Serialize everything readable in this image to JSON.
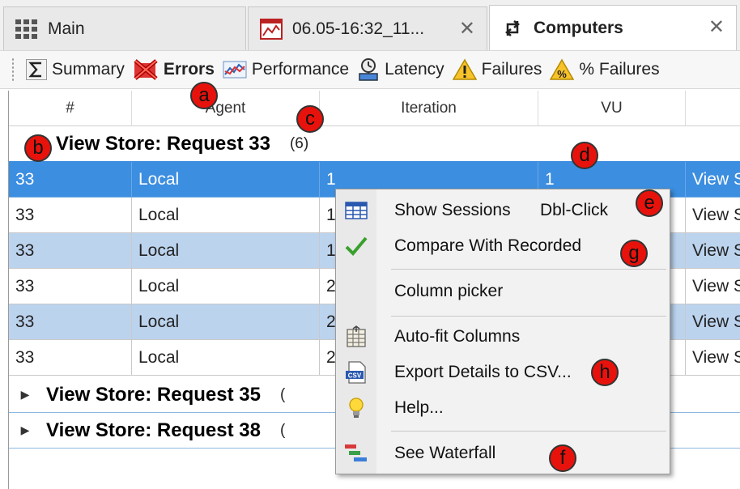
{
  "tabs": [
    {
      "label": "Main",
      "icon": "grid-icon",
      "closable": false,
      "active": false
    },
    {
      "label": "06.05-16:32_11...",
      "icon": "chart-icon",
      "closable": true,
      "active": false
    },
    {
      "label": "Computers",
      "icon": "swap-arrows-icon",
      "closable": true,
      "active": true
    }
  ],
  "tab_close_glyph": "✕",
  "toolbar": {
    "items": [
      {
        "label": "Summary",
        "icon": "sigma-icon"
      },
      {
        "label": "Errors",
        "icon": "errors-icon",
        "bold": true
      },
      {
        "label": "Performance",
        "icon": "performance-icon"
      },
      {
        "label": "Latency",
        "icon": "latency-icon"
      },
      {
        "label": "Failures",
        "icon": "warning-icon"
      },
      {
        "label": "% Failures",
        "icon": "percent-failures-icon"
      }
    ]
  },
  "grid": {
    "columns": [
      "#",
      "Agent",
      "Iteration",
      "VU",
      ""
    ],
    "groups": [
      {
        "title": "View Store: Request 33",
        "count": "(6)",
        "expanded": true
      },
      {
        "title": "View Store: Request 35",
        "count": "(",
        "expanded": false
      },
      {
        "title": "View Store: Request 38",
        "count": "(",
        "expanded": false
      }
    ],
    "rows": [
      {
        "num": "33",
        "agent": "Local",
        "iteration": "1",
        "vu": "1",
        "extra": "View S",
        "state": "selected"
      },
      {
        "num": "33",
        "agent": "Local",
        "iteration": "1",
        "vu": "",
        "extra": "View S",
        "state": "normal"
      },
      {
        "num": "33",
        "agent": "Local",
        "iteration": "1",
        "vu": "",
        "extra": "View S",
        "state": "alt"
      },
      {
        "num": "33",
        "agent": "Local",
        "iteration": "2",
        "vu": "",
        "extra": "View S",
        "state": "normal"
      },
      {
        "num": "33",
        "agent": "Local",
        "iteration": "2",
        "vu": "",
        "extra": "View S",
        "state": "alt"
      },
      {
        "num": "33",
        "agent": "Local",
        "iteration": "2",
        "vu": "",
        "extra": "View S",
        "state": "normal"
      }
    ]
  },
  "context_menu": {
    "items": [
      {
        "label": "Show Sessions",
        "shortcut": "Dbl-Click",
        "icon": "sessions-table-icon"
      },
      {
        "label": "Compare With Recorded",
        "shortcut": "",
        "icon": "checkmark-icon"
      },
      {
        "label": "Column picker",
        "shortcut": "",
        "icon": ""
      },
      {
        "label": "Auto-fit Columns",
        "shortcut": "",
        "icon": "autofit-columns-icon"
      },
      {
        "label": "Export Details to CSV...",
        "shortcut": "",
        "icon": "csv-file-icon"
      },
      {
        "label": "Help...",
        "shortcut": "",
        "icon": "lightbulb-icon"
      },
      {
        "label": "See Waterfall",
        "shortcut": "",
        "icon": "waterfall-icon"
      }
    ]
  },
  "callouts": {
    "a": "a",
    "b": "b",
    "c": "c",
    "d": "d",
    "e": "e",
    "f": "f",
    "g": "g",
    "h": "h"
  },
  "colors": {
    "selected_row": "#3c8ee0",
    "alt_row": "#bcd3ee",
    "callout": "#e8120c"
  }
}
